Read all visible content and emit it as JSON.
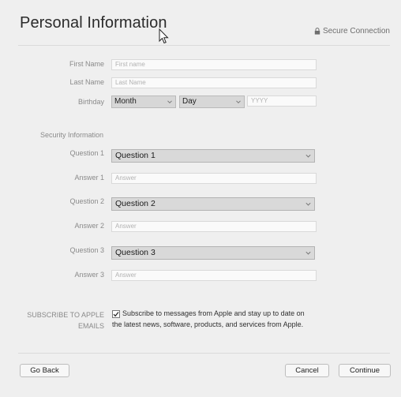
{
  "header": {
    "title": "Personal Information",
    "secure_label": "Secure Connection"
  },
  "fields": {
    "first_name": {
      "label": "First Name",
      "placeholder": "First name"
    },
    "last_name": {
      "label": "Last Name",
      "placeholder": "Last Name"
    },
    "birthday": {
      "label": "Birthday",
      "month": "Month",
      "day": "Day",
      "year_placeholder": "YYYY"
    }
  },
  "security": {
    "section_label": "Security Information",
    "questions": [
      {
        "label": "Question 1",
        "value": "Question 1",
        "answer_label": "Answer 1",
        "answer_placeholder": "Answer"
      },
      {
        "label": "Question 2",
        "value": "Question 2",
        "answer_label": "Answer 2",
        "answer_placeholder": "Answer"
      },
      {
        "label": "Question 3",
        "value": "Question 3",
        "answer_label": "Answer 3",
        "answer_placeholder": "Answer"
      }
    ]
  },
  "subscribe": {
    "label_line1": "SUBSCRIBE TO APPLE",
    "label_line2": "EMAILS",
    "text_line1": "Subscribe to messages from Apple and stay up to date on",
    "text_line2": "the latest news, software, products, and services from Apple.",
    "checked": true
  },
  "footer": {
    "back_label": "Go Back",
    "cancel_label": "Cancel",
    "continue_label": "Continue"
  },
  "icons": {
    "lock": "lock-icon",
    "chevron": "chevron-down-icon",
    "check": "checkmark-icon",
    "cursor": "mouse-cursor-icon"
  }
}
